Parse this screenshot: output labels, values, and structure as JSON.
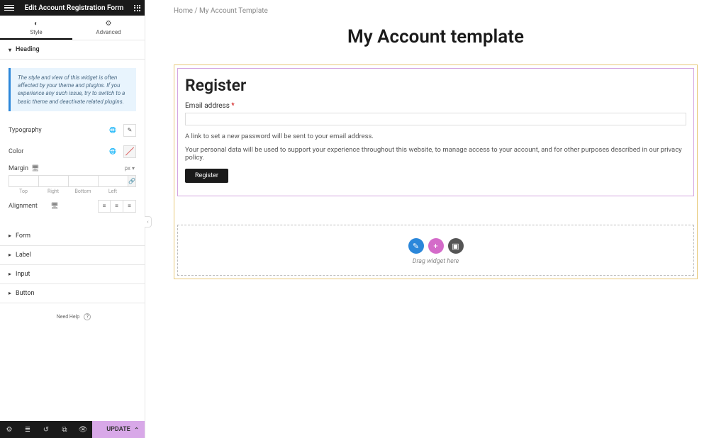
{
  "sidebar": {
    "title": "Edit Account Registration Form",
    "tabs": {
      "style": "Style",
      "advanced": "Advanced"
    },
    "sections": {
      "heading": "Heading",
      "form": "Form",
      "label": "Label",
      "input": "Input",
      "button": "Button"
    },
    "notice": "The style and view of this widget is often affected by your theme and plugins. If you experience any such issue, try to switch to a basic theme and deactivate related plugins.",
    "controls": {
      "typography": "Typography",
      "color": "Color",
      "margin": "Margin",
      "margin_unit": "px",
      "margin_sides": {
        "top": "Top",
        "right": "Right",
        "bottom": "Bottom",
        "left": "Left"
      },
      "alignment": "Alignment"
    },
    "help": "Need Help",
    "footer": {
      "update": "UPDATE"
    }
  },
  "canvas": {
    "breadcrumb": {
      "home": "Home",
      "sep": " / ",
      "current": "My Account Template"
    },
    "page_title": "My Account template",
    "register": {
      "heading": "Register",
      "email_label": "Email address",
      "req": "*",
      "hint": "A link to set a new password will be sent to your email address.",
      "privacy": "Your personal data will be used to support your experience throughout this website, to manage access to your account, and for other purposes described in our ",
      "privacy_link": "privacy policy",
      "privacy_end": ".",
      "button": "Register"
    },
    "dropzone": {
      "text": "Drag widget here"
    }
  }
}
